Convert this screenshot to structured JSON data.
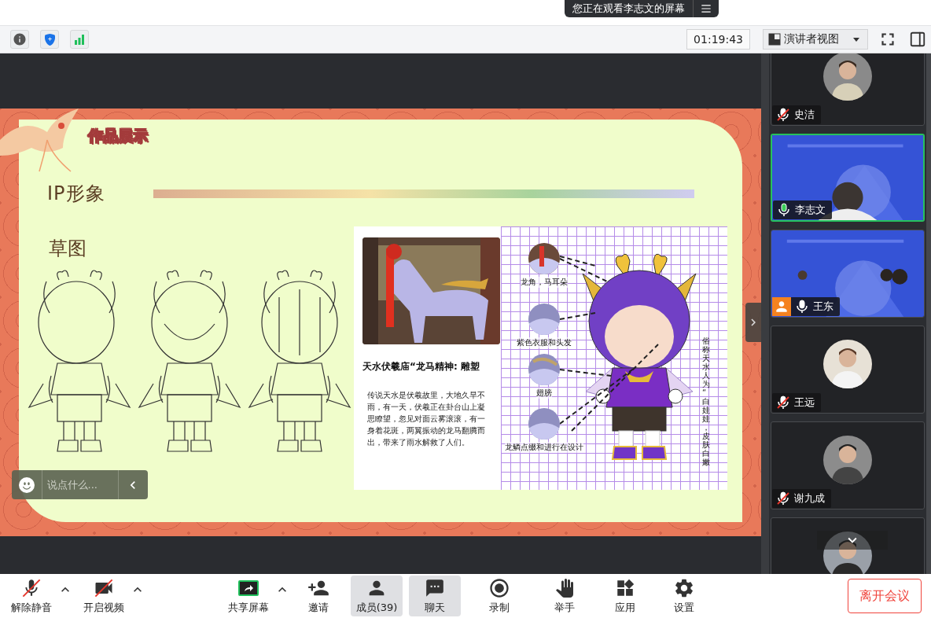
{
  "banner": {
    "text": "您正在观看李志文的屏幕"
  },
  "toolbar": {
    "timer": "01:19:43",
    "view_mode": "演讲者视图"
  },
  "slide": {
    "badge": "作品展示",
    "heading": "IP形象",
    "subheading": "草图",
    "photo_caption": "天水伏羲庙“龙马精神: 雕塑",
    "story": "传说天水是伏羲故里，大地久旱不雨，有一天，伏羲正在卦台山上凝思瞭望，忽见对面云雾滚滚，有一身着花斑，两翼振动的龙马翻腾而出，带来了雨水解救了人们。",
    "callouts": [
      "龙角，马耳朵",
      "紫色衣服和头发",
      "翅膀",
      "龙鳞点缀和进行在设计"
    ],
    "vertical_note": "俗称天水人为“白娃娃，皮肤白嫩"
  },
  "chat_input": {
    "placeholder": "说点什么..."
  },
  "participants": [
    {
      "name": "史洁",
      "muted": true,
      "speaking": false,
      "video": false,
      "active": false,
      "host_badge": false
    },
    {
      "name": "李志文",
      "muted": false,
      "speaking": true,
      "video": true,
      "active": true,
      "host_badge": false
    },
    {
      "name": "王东",
      "muted": false,
      "speaking": false,
      "video": true,
      "active": false,
      "host_badge": true
    },
    {
      "name": "王远",
      "muted": true,
      "speaking": false,
      "video": false,
      "active": false,
      "host_badge": false
    },
    {
      "name": "谢九成",
      "muted": true,
      "speaking": false,
      "video": false,
      "active": false,
      "host_badge": false
    }
  ],
  "controls": [
    {
      "label": "解除静音",
      "kind": "mic-off",
      "caret": true,
      "selected": false
    },
    {
      "label": "开启视频",
      "kind": "video-off",
      "caret": true,
      "selected": false
    },
    {
      "label": "共享屏幕",
      "kind": "share",
      "caret": true,
      "selected": false
    },
    {
      "label": "邀请",
      "kind": "invite",
      "caret": false,
      "selected": false
    },
    {
      "label": "成员(39)",
      "kind": "members",
      "caret": false,
      "selected": true
    },
    {
      "label": "聊天",
      "kind": "chat",
      "caret": false,
      "selected": true
    },
    {
      "label": "录制",
      "kind": "record",
      "caret": false,
      "selected": false
    },
    {
      "label": "举手",
      "kind": "hand",
      "caret": false,
      "selected": false
    },
    {
      "label": "应用",
      "kind": "apps",
      "caret": false,
      "selected": false
    },
    {
      "label": "设置",
      "kind": "settings",
      "caret": false,
      "selected": false
    }
  ],
  "leave_button": "离开会议"
}
